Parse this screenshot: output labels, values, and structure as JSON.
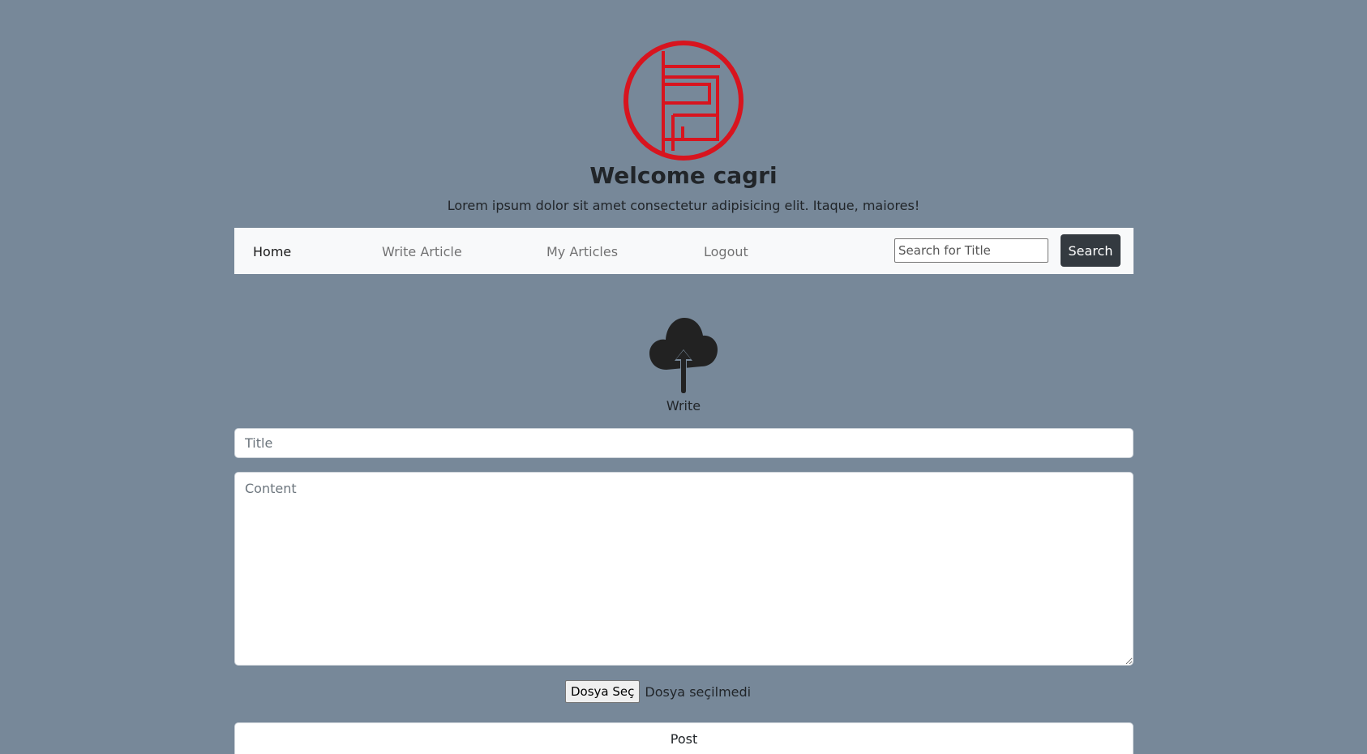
{
  "header": {
    "logo": "red-circle-emblem-logo",
    "welcome": "Welcome cagri",
    "tagline": "Lorem ipsum dolor sit amet consectetur adipisicing elit. Itaque, maiores!"
  },
  "nav": {
    "home": "Home",
    "write_article": "Write Article",
    "my_articles": "My Articles",
    "logout": "Logout",
    "search_placeholder": "Search for Title",
    "search_button": "Search"
  },
  "form": {
    "icon": "cloud-upload-icon",
    "caption": "Write",
    "title_placeholder": "Title",
    "content_placeholder": "Content",
    "file_button": "Dosya Seç",
    "file_status": "Dosya seçilmedi",
    "post_button": "Post"
  },
  "colors": {
    "background": "#778899",
    "navbar": "#f8f9fa",
    "search_button": "#343a40",
    "logo_red": "#d8141e",
    "icon_dark": "#222222"
  }
}
